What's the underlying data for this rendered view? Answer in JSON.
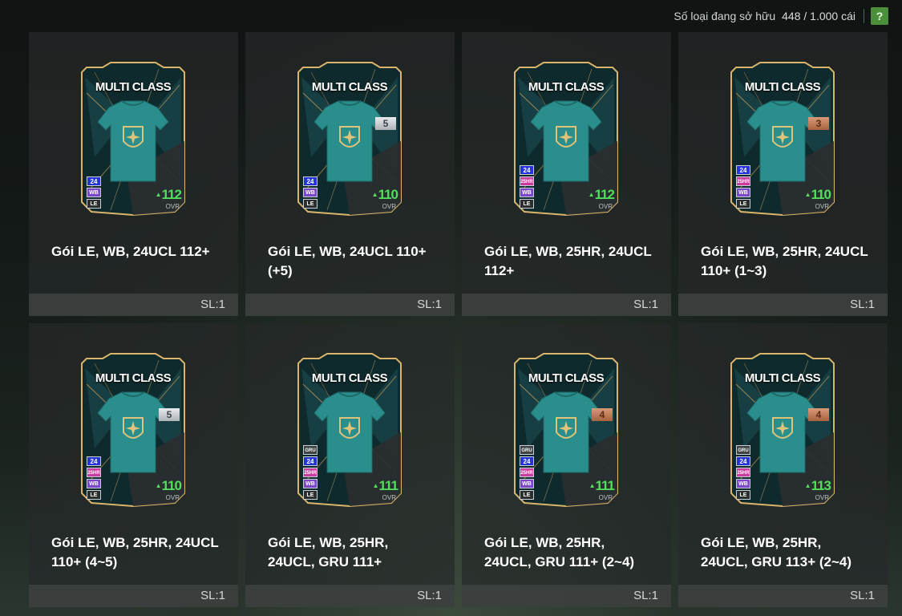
{
  "header": {
    "label": "Số loại đang sở hữu",
    "count": "448 / 1.000 cái",
    "help": "?"
  },
  "card_common": {
    "title": "MULTI CLASS",
    "ovr_label": "OVR"
  },
  "items": [
    {
      "name": "Gói LE, WB, 24UCL 112+",
      "qty": "SL:1",
      "ovr": "112",
      "level": "",
      "level_color": "",
      "badges": [
        "24",
        "WB",
        "LE"
      ]
    },
    {
      "name": "Gói LE, WB, 24UCL 110+ (+5)",
      "qty": "SL:1",
      "ovr": "110",
      "level": "5",
      "level_color": "silver",
      "badges": [
        "24",
        "WB",
        "LE"
      ]
    },
    {
      "name": "Gói LE, WB, 25HR, 24UCL 112+",
      "qty": "SL:1",
      "ovr": "112",
      "level": "",
      "level_color": "",
      "badges": [
        "24",
        "25HR",
        "WB",
        "LE"
      ]
    },
    {
      "name": "Gói LE, WB, 25HR, 24UCL 110+ (1~3)",
      "qty": "SL:1",
      "ovr": "110",
      "level": "3",
      "level_color": "bronze",
      "badges": [
        "24",
        "25HR",
        "WB",
        "LE"
      ]
    },
    {
      "name": "Gói LE, WB, 25HR, 24UCL 110+ (4~5)",
      "qty": "SL:1",
      "ovr": "110",
      "level": "5",
      "level_color": "silver",
      "badges": [
        "24",
        "25HR",
        "WB",
        "LE"
      ]
    },
    {
      "name": "Gói LE, WB, 25HR, 24UCL, GRU 111+",
      "qty": "SL:1",
      "ovr": "111",
      "level": "",
      "level_color": "",
      "badges": [
        "GRU",
        "24",
        "25HR",
        "WB",
        "LE"
      ]
    },
    {
      "name": "Gói LE, WB, 25HR, 24UCL, GRU 111+ (2~4)",
      "qty": "SL:1",
      "ovr": "111",
      "level": "4",
      "level_color": "bronze",
      "badges": [
        "GRU",
        "24",
        "25HR",
        "WB",
        "LE"
      ]
    },
    {
      "name": "Gói LE, WB, 25HR, 24UCL, GRU 113+ (2~4)",
      "qty": "SL:1",
      "ovr": "113",
      "level": "4",
      "level_color": "bronze",
      "badges": [
        "GRU",
        "24",
        "25HR",
        "WB",
        "LE"
      ]
    }
  ]
}
